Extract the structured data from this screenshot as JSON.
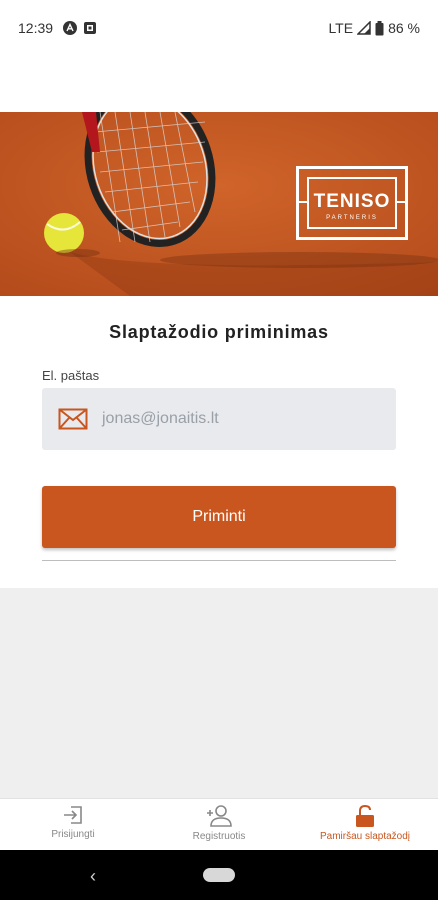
{
  "status_bar": {
    "time": "12:39",
    "network": "LTE",
    "battery": "86 %",
    "icons": [
      "notification-a-icon",
      "screenshot-icon",
      "signal-icon",
      "battery-icon"
    ]
  },
  "hero": {
    "logo_title": "TENISO",
    "logo_subtitle": "PARTNERIS"
  },
  "form": {
    "title": "Slaptažodio priminimas",
    "email_label": "El. paštas",
    "email_placeholder": "jonas@jonaitis.lt",
    "submit_label": "Priminti"
  },
  "bottom_nav": {
    "items": [
      {
        "label": "Prisijungti",
        "icon": "login-icon",
        "active": false
      },
      {
        "label": "Registruotis",
        "icon": "add-user-icon",
        "active": false
      },
      {
        "label": "Pamiršau slaptažodį",
        "icon": "unlock-icon",
        "active": true
      }
    ]
  },
  "colors": {
    "accent": "#c9561f",
    "clay": "#c2551f",
    "input_bg": "#e8eaee",
    "page_bg": "#efefef"
  }
}
